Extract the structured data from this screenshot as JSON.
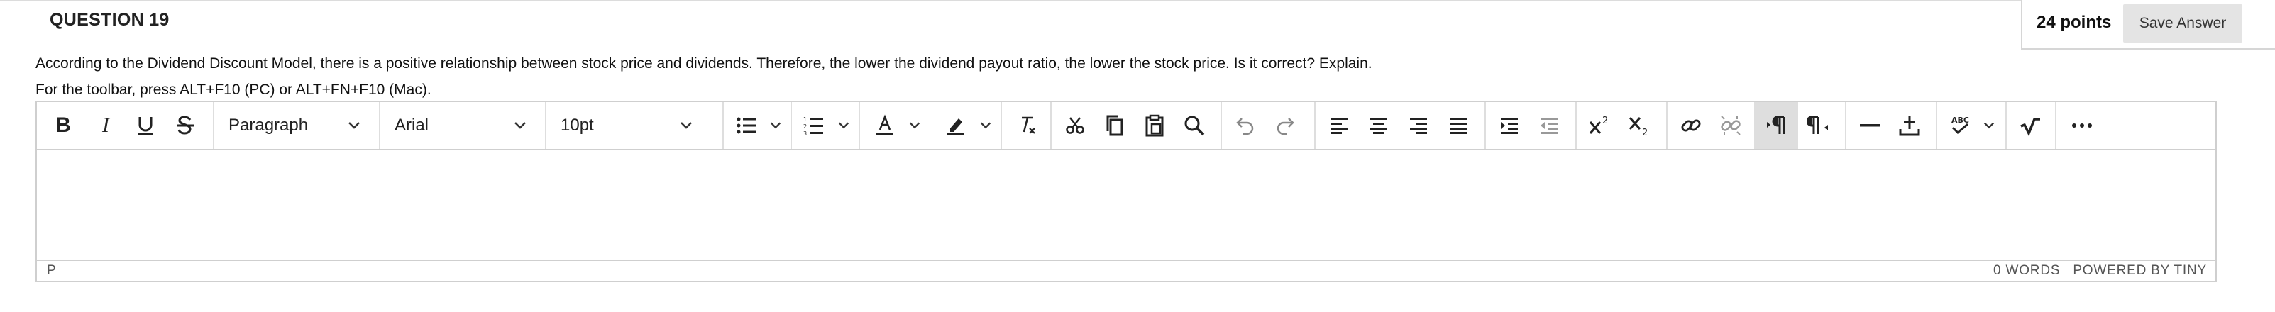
{
  "question": {
    "title": "QUESTION 19",
    "points": "24 points",
    "save_label": "Save Answer",
    "text": "According to the Dividend Discount Model, there is a positive relationship between stock price and dividends. Therefore, the lower the dividend payout ratio, the lower the stock price. Is it correct? Explain.",
    "toolbar_hint": "For the toolbar, press ALT+F10 (PC) or ALT+FN+F10 (Mac)."
  },
  "editor": {
    "block_format": "Paragraph",
    "font_family": "Arial",
    "font_size": "10pt",
    "content": "",
    "status_path": "P",
    "word_count": "0 WORDS",
    "powered_by": "POWERED BY TINY",
    "toolbar_icons": [
      "bold-icon",
      "italic-icon",
      "underline-icon",
      "strikethrough-icon",
      "bullet-list-icon",
      "numbered-list-icon",
      "text-color-icon",
      "highlight-color-icon",
      "clear-formatting-icon",
      "cut-icon",
      "copy-icon",
      "paste-icon",
      "find-icon",
      "undo-icon",
      "redo-icon",
      "align-left-icon",
      "align-center-icon",
      "align-right-icon",
      "justify-icon",
      "indent-icon",
      "outdent-icon",
      "superscript-icon",
      "subscript-icon",
      "link-icon",
      "unlink-icon",
      "ltr-icon",
      "rtl-icon",
      "horizontal-rule-icon",
      "insert-icon",
      "spellcheck-icon",
      "math-icon",
      "more-icon"
    ],
    "active_tool": "ltr-icon"
  },
  "colors": {
    "border": "#cfcfcf",
    "active_button_bg": "#dedede",
    "save_button_bg": "#e4e4e4",
    "text": "#222222"
  }
}
